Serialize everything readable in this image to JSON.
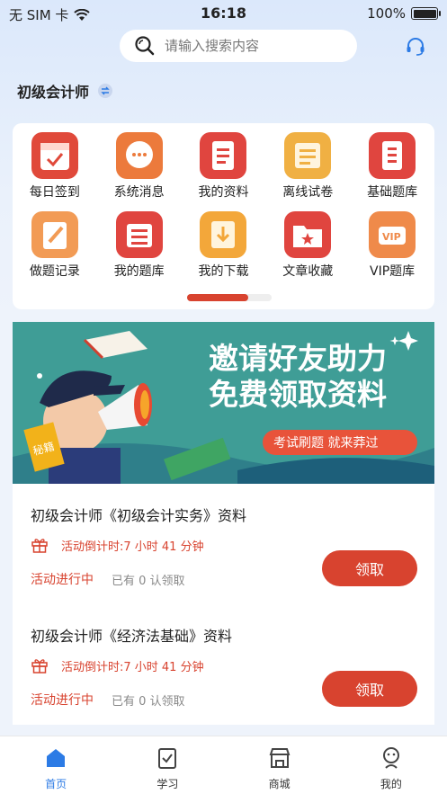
{
  "status": {
    "carrier": "无 SIM 卡",
    "time": "16:18",
    "battery": "100%"
  },
  "search": {
    "placeholder": "请输入搜索内容"
  },
  "exam": {
    "name": "初级会计师"
  },
  "grid": [
    {
      "label": "每日签到",
      "icon": "calendar-check-icon",
      "color": "#e0493a"
    },
    {
      "label": "系统消息",
      "icon": "message-icon",
      "color": "#ec7a3c"
    },
    {
      "label": "我的资料",
      "icon": "document-icon",
      "color": "#e0453f"
    },
    {
      "label": "离线试卷",
      "icon": "paper-icon",
      "color": "#f0b043"
    },
    {
      "label": "基础题库",
      "icon": "book-icon",
      "color": "#e0453f"
    },
    {
      "label": "做题记录",
      "icon": "note-pencil-icon",
      "color": "#f29b55"
    },
    {
      "label": "我的题库",
      "icon": "question-bank-icon",
      "color": "#e0453f"
    },
    {
      "label": "我的下载",
      "icon": "download-icon",
      "color": "#f3a73a"
    },
    {
      "label": "文章收藏",
      "icon": "folder-star-icon",
      "color": "#e0453f"
    },
    {
      "label": "VIP题库",
      "icon": "vip-icon",
      "color": "#ef8a4a"
    }
  ],
  "pager": {
    "progress": 0.72
  },
  "banner": {
    "headline1": "邀请好友助力",
    "headline2": "免费领取资料",
    "tag": "考试刷题 就来莽过",
    "book_text": "秘籍"
  },
  "items": [
    {
      "title": "初级会计师《初级会计实务》资料",
      "countdown": "活动倒计时:7 小时 41 分钟",
      "status": "活动进行中",
      "count": "已有 0 认领取",
      "button": "领取"
    },
    {
      "title": "初级会计师《经济法基础》资料",
      "countdown": "活动倒计时:7 小时 41 分钟",
      "status": "活动进行中",
      "count": "已有 0 认领取",
      "button": "领取"
    }
  ],
  "tabs": [
    {
      "label": "首页",
      "icon": "home-icon",
      "active": true
    },
    {
      "label": "学习",
      "icon": "study-icon",
      "active": false
    },
    {
      "label": "商城",
      "icon": "shop-icon",
      "active": false
    },
    {
      "label": "我的",
      "icon": "profile-icon",
      "active": false
    }
  ],
  "colors": {
    "accent": "#d8432f",
    "tab_active": "#2c7be5",
    "banner_bg": "#3f9d96"
  }
}
